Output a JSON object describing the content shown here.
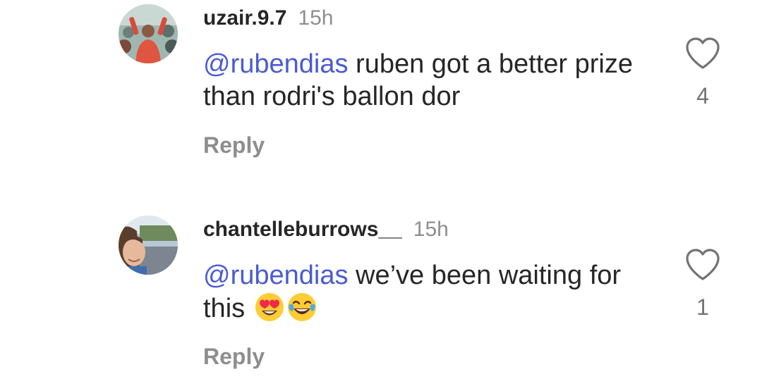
{
  "comments": [
    {
      "username": "uzair.9.7",
      "time": "15h",
      "mention": "@rubendias",
      "text": " ruben got a better prize than rodri's ballon dor",
      "reply_label": "Reply",
      "like_count": "4",
      "avatar_icon": "user-avatar-photo-crowd",
      "like_icon": "heart-outline-icon"
    },
    {
      "username": "chantelleburrows__",
      "time": "15h",
      "mention": "@rubendias",
      "text": " we’ve been waiting for this ",
      "emojis": [
        "heart-eyes-emoji",
        "tears-of-joy-emoji"
      ],
      "reply_label": "Reply",
      "like_count": "1",
      "avatar_icon": "user-avatar-photo-selfie",
      "like_icon": "heart-outline-icon"
    }
  ],
  "colors": {
    "mention": "#4a5bd4",
    "text": "#262626",
    "muted": "#8e8e8e"
  }
}
